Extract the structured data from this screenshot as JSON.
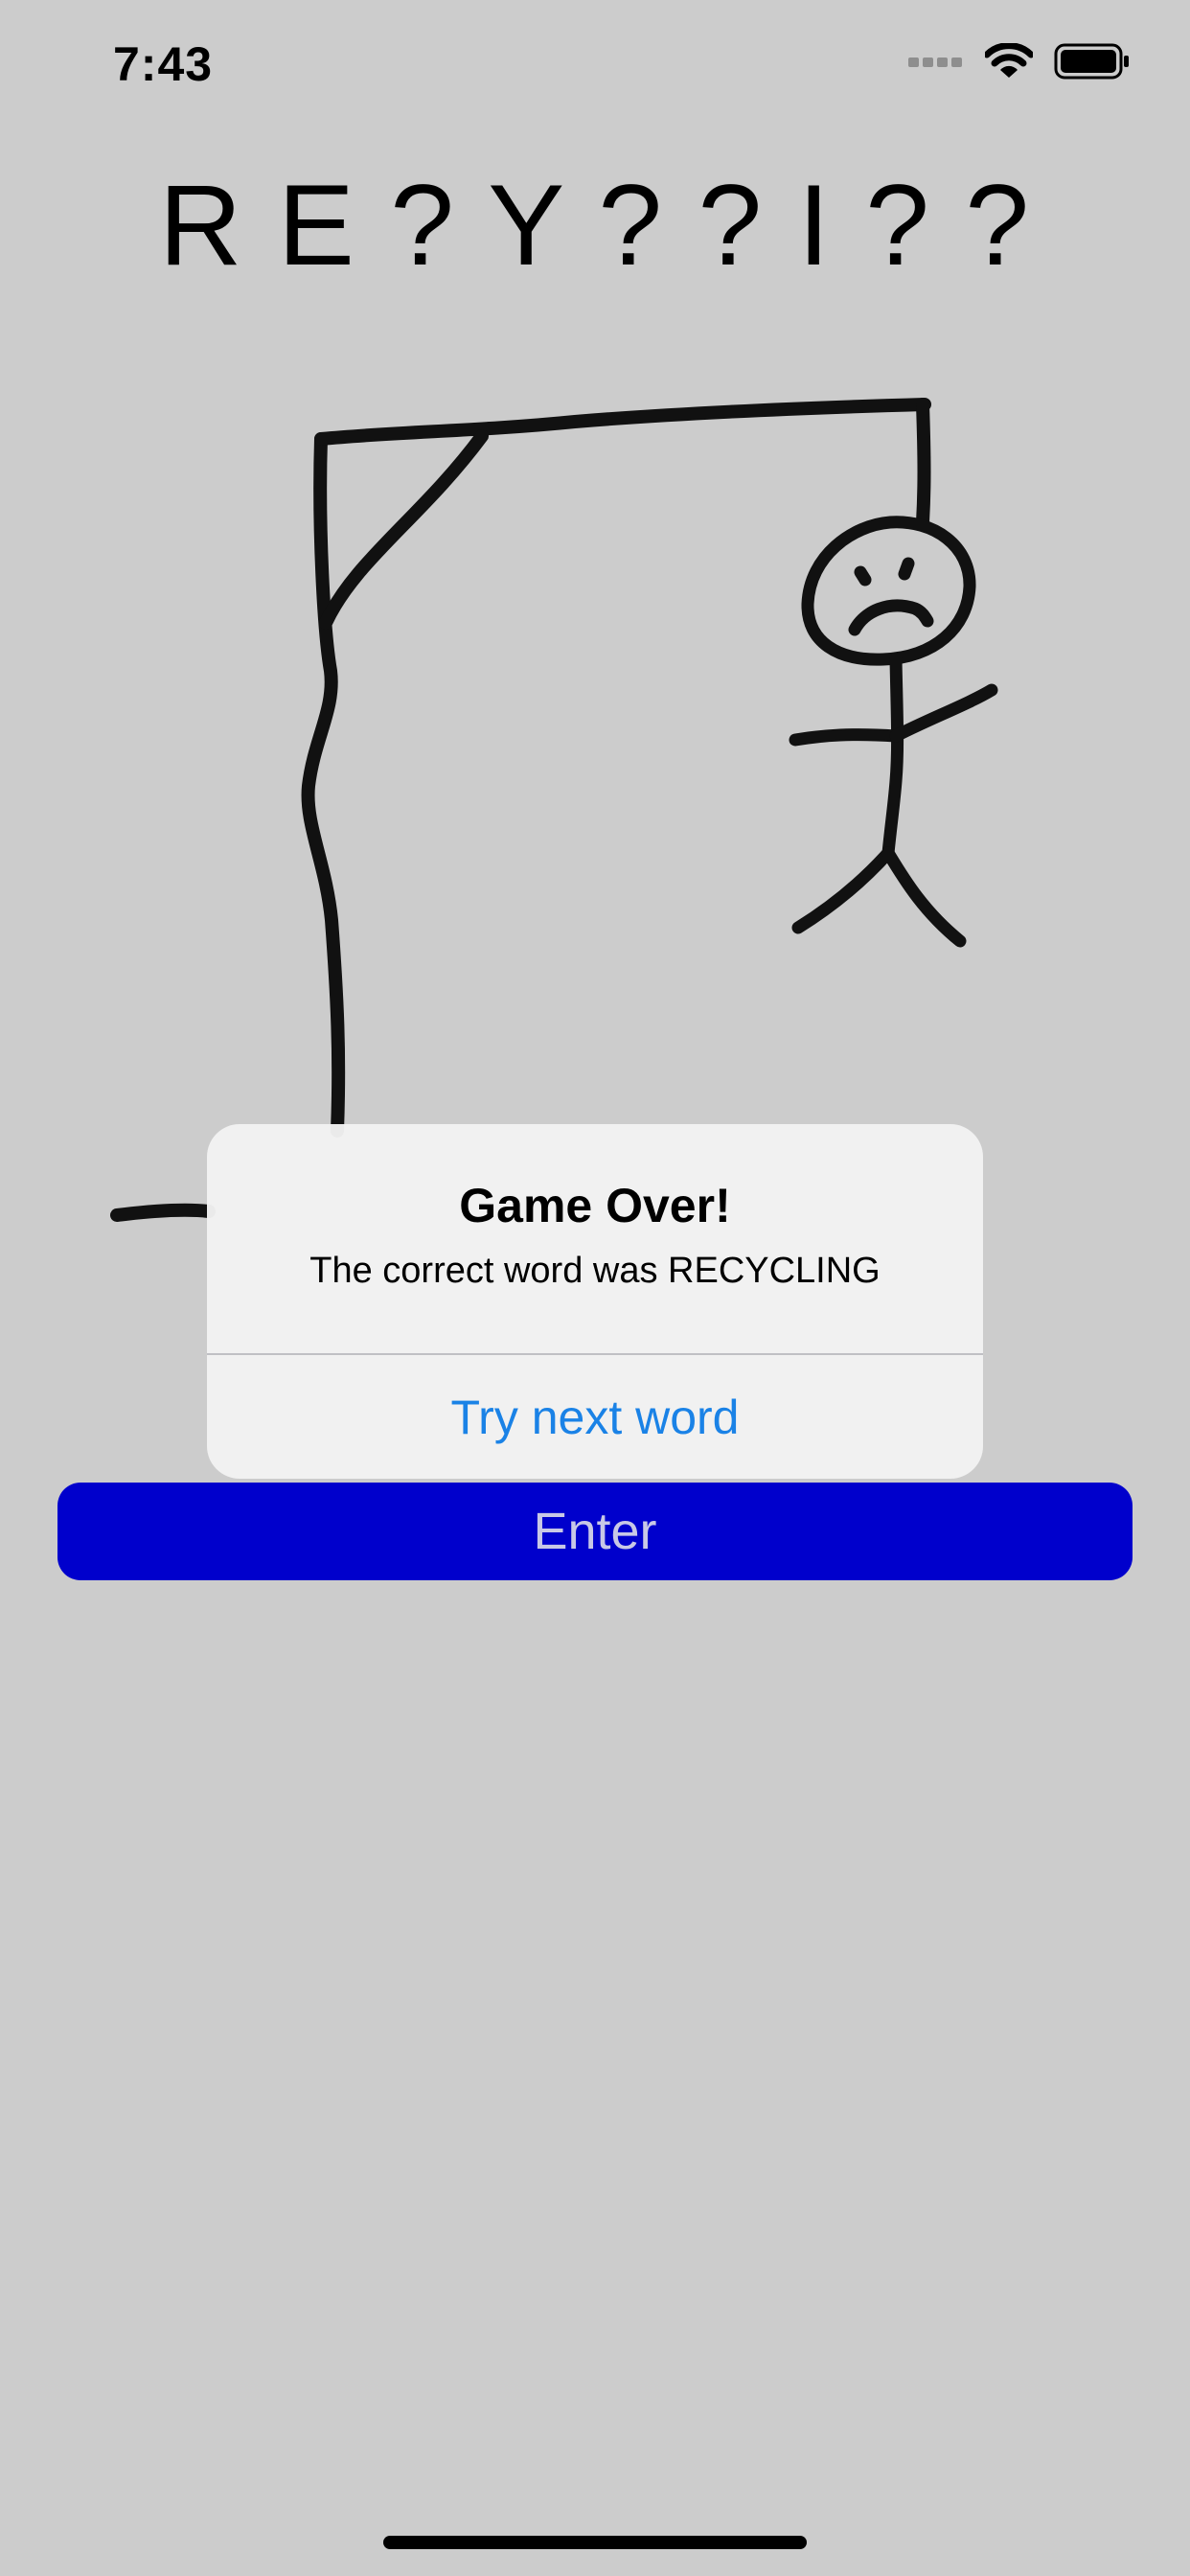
{
  "status_bar": {
    "time": "7:43",
    "icons": [
      "cellular-signal-icon",
      "wifi-icon",
      "battery-icon"
    ]
  },
  "game": {
    "word_display": "R E ? Y ? ? I ? ?",
    "misses_drawn": [
      "gallows",
      "head",
      "body",
      "left-arm",
      "right-arm",
      "left-leg",
      "right-leg"
    ]
  },
  "alert": {
    "title": "Game Over!",
    "message": "The correct word was RECYCLING",
    "action_label": "Try next word"
  },
  "input": {
    "enter_label": "Enter"
  },
  "colors": {
    "background": "#cccccc",
    "enter_button": "#0000cc",
    "enter_text": "#c8c8e6",
    "alert_action": "#1a82e6"
  }
}
